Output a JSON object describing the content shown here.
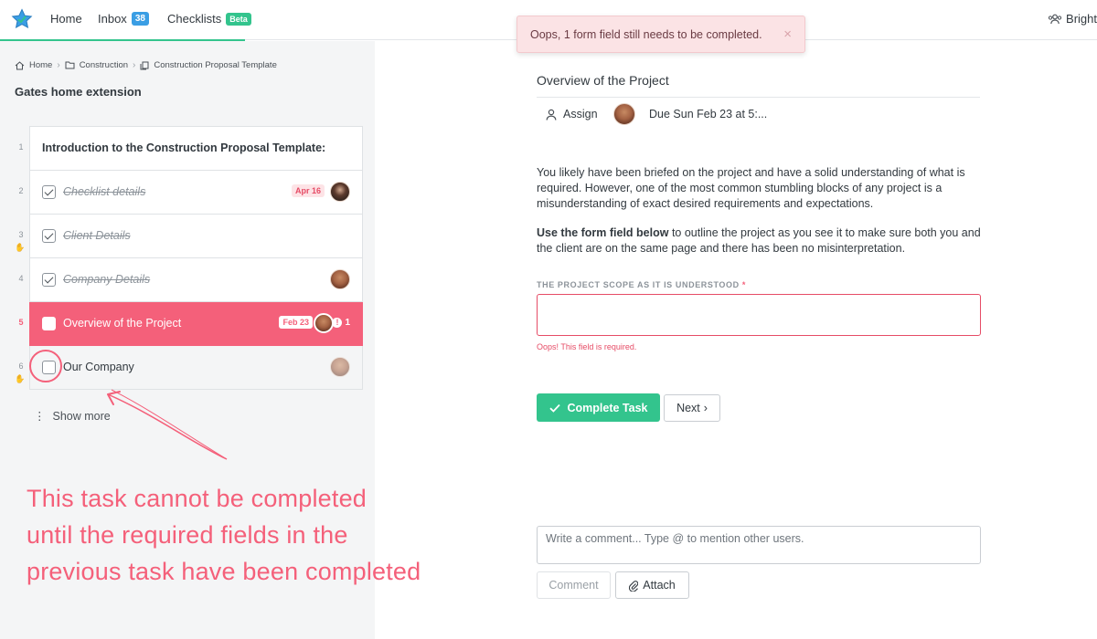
{
  "nav": {
    "home": "Home",
    "inbox": "Inbox",
    "inbox_count": "38",
    "checklists": "Checklists",
    "beta": "Beta",
    "org": "Bright"
  },
  "toast": {
    "message": "Oops, 1 form field still needs to be completed.",
    "close": "×"
  },
  "breadcrumb": {
    "home": "Home",
    "folder": "Construction",
    "template": "Construction Proposal Template"
  },
  "checklist_title": "Gates home extension",
  "tasks": [
    {
      "num": "1",
      "label": "Introduction to the Construction Proposal Template:"
    },
    {
      "num": "2",
      "label": "Checklist details",
      "due": "Apr 16"
    },
    {
      "num": "3",
      "label": "Client Details"
    },
    {
      "num": "4",
      "label": "Company Details"
    },
    {
      "num": "5",
      "label": "Overview of the Project",
      "due": "Feb 23",
      "warnings": "1"
    },
    {
      "num": "6",
      "label": "Our Company"
    }
  ],
  "show_more": "Show more",
  "annotation": {
    "lines": [
      "This task cannot be completed",
      "until the required fields in the",
      "previous task have been completed"
    ],
    "color": "#f4607a"
  },
  "task_detail": {
    "title": "Overview of the Project",
    "assign": "Assign",
    "due": "Due Sun Feb 23 at 5:...",
    "paragraph1": "You likely have been briefed on the project and have a solid understanding of what is required. However, one of the most common stumbling blocks of any project is a misunderstanding of exact desired requirements and expectations.",
    "paragraph2_bold": "Use the form field below",
    "paragraph2_rest": " to outline the project as you see it to make sure both you and the client are on the same page and there has been no misinterpretation.",
    "field_label": "THE PROJECT SCOPE AS IT IS UNDERSTOOD",
    "field_required": "*",
    "field_value": "",
    "field_error": "Oops! This field is required.",
    "complete_button": "Complete Task",
    "next_button": "Next",
    "comment_placeholder": "Write a comment... Type @ to mention other users.",
    "comment_button": "Comment",
    "attach_button": "Attach"
  },
  "colors": {
    "accent_green": "#33c48d",
    "active_red": "#f4607a",
    "inbox_blue": "#3a9ee4"
  }
}
